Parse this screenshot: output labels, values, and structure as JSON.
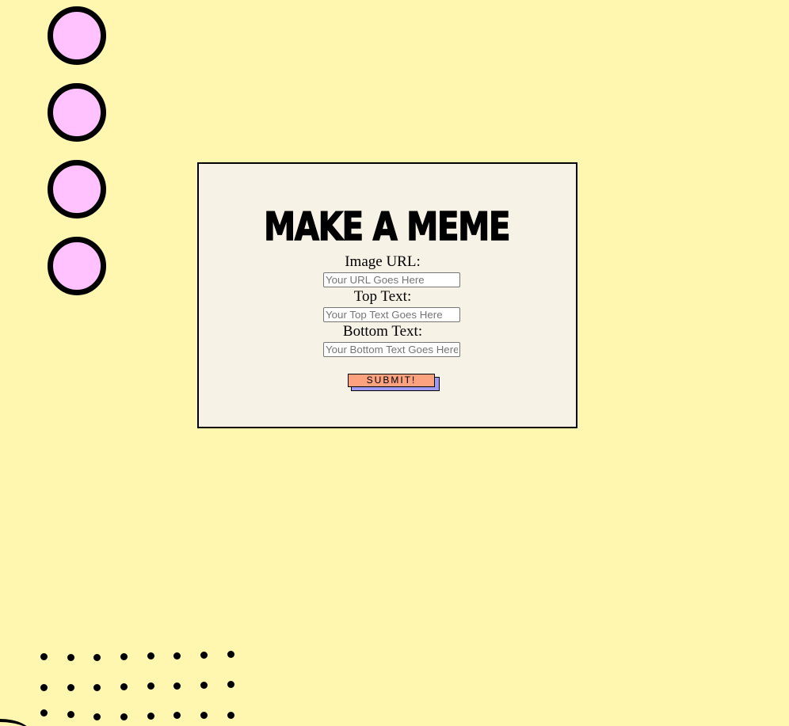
{
  "form": {
    "title": "MAKE A MEME",
    "image_url": {
      "label": "Image URL:",
      "placeholder": "Your URL Goes Here",
      "value": ""
    },
    "top_text": {
      "label": "Top Text:",
      "placeholder": "Your Top Text Goes Here",
      "value": ""
    },
    "bottom_text": {
      "label": "Bottom Text:",
      "placeholder": "Your Bottom Text Goes Here",
      "value": ""
    },
    "submit_label": "SUBMIT!"
  },
  "colors": {
    "background": "#fff6b0",
    "card": "#f7f2e6",
    "circle_fill": "#ffc2ff",
    "submit": "#fca27f",
    "submit_shadow": "#9e9af2"
  },
  "decorations": {
    "circle_count": 4,
    "dot_grid": {
      "rows": 3,
      "cols": 8
    }
  }
}
